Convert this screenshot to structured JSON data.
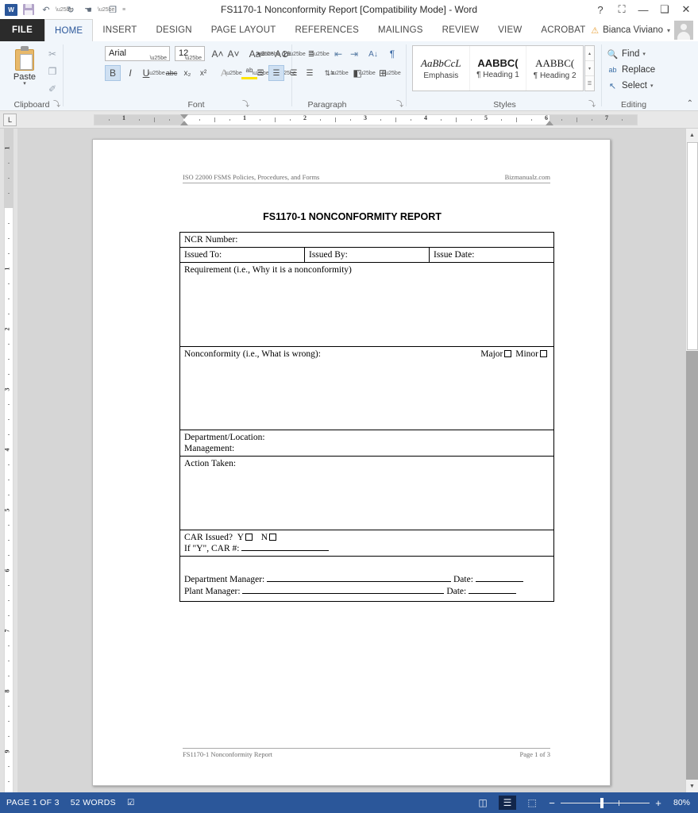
{
  "titlebar": {
    "document_title": "FS1170-1 Nonconformity Report [Compatibility Mode] - Word",
    "qat": [
      {
        "name": "word-logo-icon",
        "label": "W"
      },
      {
        "name": "save-icon",
        "label": ""
      },
      {
        "name": "undo-icon",
        "label": "↶"
      },
      {
        "name": "redo-icon",
        "label": "↻"
      },
      {
        "name": "touch-mode-icon",
        "label": "☚"
      },
      {
        "name": "copy-icon",
        "label": "❐"
      },
      {
        "name": "customize-qat-icon",
        "label": "≡"
      }
    ],
    "window_buttons": [
      {
        "name": "help-button",
        "label": "?"
      },
      {
        "name": "ribbon-display-options-button",
        "label": "⛶"
      },
      {
        "name": "minimize-button",
        "label": "—"
      },
      {
        "name": "restore-button",
        "label": "❑"
      },
      {
        "name": "close-button",
        "label": "✕"
      }
    ]
  },
  "tabs": {
    "file_label": "FILE",
    "items": [
      "HOME",
      "INSERT",
      "DESIGN",
      "PAGE LAYOUT",
      "REFERENCES",
      "MAILINGS",
      "REVIEW",
      "VIEW",
      "ACROBAT"
    ],
    "active": "HOME",
    "user_name": "Bianca Viviano",
    "user_caret": "▾",
    "warning_icon": "⚠"
  },
  "ribbon": {
    "clipboard": {
      "group_label": "Clipboard",
      "paste_label": "Paste",
      "paste_caret": "▾",
      "buttons": [
        {
          "name": "cut-button",
          "glyph": "✂"
        },
        {
          "name": "copy-button",
          "glyph": "❐"
        },
        {
          "name": "format-painter-button",
          "glyph": "✐"
        }
      ],
      "dialog_launcher": "⤵"
    },
    "font": {
      "group_label": "Font",
      "font_name": "Arial",
      "font_size": "12",
      "row1": [
        {
          "name": "grow-font-button",
          "glyph": "A˄"
        },
        {
          "name": "shrink-font-button",
          "glyph": "A˅"
        },
        {
          "name": "change-case-button",
          "glyph": "Aa"
        },
        {
          "name": "clear-formatting-button",
          "glyph": "A⊘"
        }
      ],
      "row2": [
        {
          "name": "bold-button",
          "glyph": "B",
          "active": true
        },
        {
          "name": "italic-button",
          "glyph": "I"
        },
        {
          "name": "underline-button",
          "glyph": "U"
        },
        {
          "name": "strikethrough-button",
          "glyph": "abc"
        },
        {
          "name": "subscript-button",
          "glyph": "x₂"
        },
        {
          "name": "superscript-button",
          "glyph": "x²"
        },
        {
          "name": "text-effects-button",
          "glyph": "A"
        },
        {
          "name": "text-highlight-color-button",
          "glyph": "ab"
        },
        {
          "name": "font-color-button",
          "glyph": "A"
        }
      ],
      "dialog_launcher": "⤵"
    },
    "paragraph": {
      "group_label": "Paragraph",
      "row1": [
        {
          "name": "bullets-button",
          "glyph": "•≡"
        },
        {
          "name": "numbering-button",
          "glyph": "1≡"
        },
        {
          "name": "multilevel-list-button",
          "glyph": "≣"
        },
        {
          "name": "decrease-indent-button",
          "glyph": "⇤"
        },
        {
          "name": "increase-indent-button",
          "glyph": "⇥"
        },
        {
          "name": "sort-button",
          "glyph": "A↓"
        },
        {
          "name": "show-formatting-marks-button",
          "glyph": "¶"
        }
      ],
      "row2": [
        {
          "name": "align-left-button",
          "glyph": "☰"
        },
        {
          "name": "align-center-button",
          "glyph": "☰",
          "active": true
        },
        {
          "name": "align-right-button",
          "glyph": "☰"
        },
        {
          "name": "justify-button",
          "glyph": "☰"
        },
        {
          "name": "line-spacing-button",
          "glyph": "⇅≡"
        },
        {
          "name": "shading-button",
          "glyph": "◧"
        },
        {
          "name": "borders-button",
          "glyph": "⊞"
        }
      ],
      "dialog_launcher": "⤵"
    },
    "styles": {
      "group_label": "Styles",
      "gallery": [
        {
          "preview": "AaBbCcL",
          "name": "Emphasis"
        },
        {
          "preview": "AABBC(",
          "name": "¶ Heading 1"
        },
        {
          "preview": "AABBC(",
          "name": "¶ Heading 2"
        }
      ],
      "scroll": [
        "▴",
        "▾",
        "☰"
      ],
      "dialog_launcher": "⤵"
    },
    "editing": {
      "group_label": "Editing",
      "items": [
        {
          "name": "find-button",
          "label": "Find",
          "icon": "🔍",
          "caret": "▾"
        },
        {
          "name": "replace-button",
          "label": "Replace",
          "icon": "ab",
          "caret": ""
        },
        {
          "name": "select-button",
          "label": "Select",
          "icon": "↖",
          "caret": "▾"
        }
      ]
    },
    "collapse_ribbon": "⌃"
  },
  "ruler": {
    "tabstop_marker": "L",
    "h_labels": [
      "1",
      "1",
      "2",
      "3",
      "4",
      "5"
    ],
    "v_labels": [
      "1",
      "1",
      "2",
      "3",
      "4",
      "5",
      "6",
      "7",
      "8"
    ]
  },
  "document": {
    "header_left": "ISO 22000 FSMS Policies, Procedures, and Forms",
    "header_right": "Bizmanualz.com",
    "title": "FS1170-1 NONCONFORMITY REPORT",
    "rows": {
      "ncr_number": "NCR Number:",
      "issued_to": "Issued To:",
      "issued_by": "Issued By:",
      "issue_date": "Issue Date:",
      "requirement": "Requirement (i.e., Why it is a nonconformity)",
      "nonconformity": "Nonconformity (i.e., What is wrong):",
      "major_label": "Major",
      "minor_label": "Minor",
      "department_location": "Department/Location:",
      "management": "Management:",
      "action_taken": "Action Taken:",
      "car_issued": "CAR Issued?",
      "car_y": "Y",
      "car_n": "N",
      "car_number": "If \"Y\", CAR #:",
      "department_manager": "Department Manager:",
      "plant_manager": "Plant Manager:",
      "date_label_1": "Date:",
      "date_label_2": "Date:"
    },
    "footer_left": "FS1170-1 Nonconformity Report",
    "footer_right": "Page 1 of 3"
  },
  "statusbar": {
    "page_info": "PAGE 1 OF 3",
    "word_count": "52 WORDS",
    "proofing_icon": "☑",
    "views": [
      {
        "name": "read-mode-button",
        "glyph": "◫",
        "active": false
      },
      {
        "name": "print-layout-button",
        "glyph": "☰",
        "active": true
      },
      {
        "name": "web-layout-button",
        "glyph": "⬚",
        "active": false
      }
    ],
    "zoom_minus": "−",
    "zoom_plus": "+",
    "zoom_level": "80%"
  },
  "scrollbar": {
    "up_arrow": "▲",
    "down_arrow": "▼"
  }
}
